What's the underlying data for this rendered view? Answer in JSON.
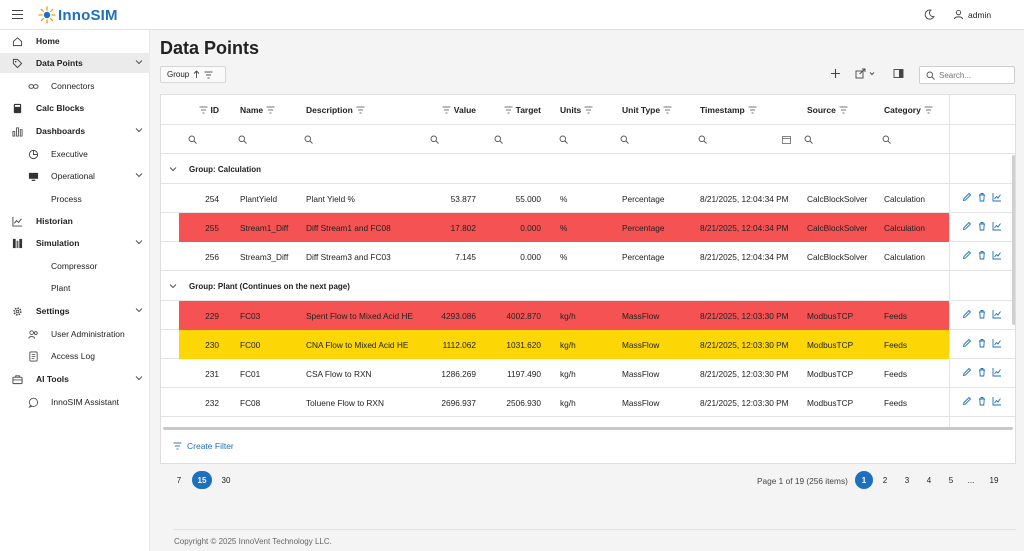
{
  "app": {
    "brand": "InnoSIM",
    "user": "admin"
  },
  "nav": {
    "home": "Home",
    "data_points": "Data Points",
    "connectors": "Connectors",
    "calc_blocks": "Calc Blocks",
    "dashboards": "Dashboards",
    "executive": "Executive",
    "operational": "Operational",
    "process": "Process",
    "historian": "Historian",
    "simulation": "Simulation",
    "compressor": "Compressor",
    "plant": "Plant",
    "settings": "Settings",
    "user_admin": "User Administration",
    "access_log": "Access Log",
    "ai_tools": "AI Tools",
    "assistant": "InnoSIM Assistant"
  },
  "page": {
    "title": "Data Points",
    "group_chip": "Group",
    "search_placeholder": "Search..."
  },
  "columns": [
    "ID",
    "Name",
    "Description",
    "Value",
    "Target",
    "Units",
    "Unit Type",
    "Timestamp",
    "Source",
    "Category"
  ],
  "groups": [
    {
      "label": "Group: Calculation"
    },
    {
      "label": "Group: Plant (Continues on the next page)"
    }
  ],
  "rows": [
    {
      "id": "254",
      "name": "PlantYield",
      "desc": "Plant Yield %",
      "value": "53.877",
      "target": "55.000",
      "units": "%",
      "unit_type": "Percentage",
      "ts": "8/21/2025, 12:04:34 PM",
      "source": "CalcBlockSolver",
      "category": "Calculation",
      "highlight": "none"
    },
    {
      "id": "255",
      "name": "Stream1_Diff",
      "desc": "Diff Stream1 and FC08",
      "value": "17.802",
      "target": "0.000",
      "units": "%",
      "unit_type": "Percentage",
      "ts": "8/21/2025, 12:04:34 PM",
      "source": "CalcBlockSolver",
      "category": "Calculation",
      "highlight": "red"
    },
    {
      "id": "256",
      "name": "Stream3_Diff",
      "desc": "Diff Stream3 and FC03",
      "value": "7.145",
      "target": "0.000",
      "units": "%",
      "unit_type": "Percentage",
      "ts": "8/21/2025, 12:04:34 PM",
      "source": "CalcBlockSolver",
      "category": "Calculation",
      "highlight": "none"
    },
    {
      "id": "229",
      "name": "FC03",
      "desc": "Spent Flow to Mixed Acid HE",
      "value": "4293.086",
      "target": "4002.870",
      "units": "kg/h",
      "unit_type": "MassFlow",
      "ts": "8/21/2025, 12:03:30 PM",
      "source": "ModbusTCP",
      "category": "Feeds",
      "highlight": "red"
    },
    {
      "id": "230",
      "name": "FC00",
      "desc": "CNA Flow to Mixed Acid HE",
      "value": "1112.062",
      "target": "1031.620",
      "units": "kg/h",
      "unit_type": "MassFlow",
      "ts": "8/21/2025, 12:03:30 PM",
      "source": "ModbusTCP",
      "category": "Feeds",
      "highlight": "yellow"
    },
    {
      "id": "231",
      "name": "FC01",
      "desc": "CSA Flow to RXN",
      "value": "1286.269",
      "target": "1197.490",
      "units": "kg/h",
      "unit_type": "MassFlow",
      "ts": "8/21/2025, 12:03:30 PM",
      "source": "ModbusTCP",
      "category": "Feeds",
      "highlight": "none"
    },
    {
      "id": "232",
      "name": "FC08",
      "desc": "Toluene Flow to RXN",
      "value": "2696.937",
      "target": "2506.930",
      "units": "kg/h",
      "unit_type": "MassFlow",
      "ts": "8/21/2025, 12:03:30 PM",
      "source": "ModbusTCP",
      "category": "Feeds",
      "highlight": "none"
    }
  ],
  "create_filter": "Create Filter",
  "pager": {
    "sizes": [
      "7",
      "15",
      "30"
    ],
    "selected_size": "15",
    "info": "Page 1 of 19 (256 items)",
    "pages": [
      "1",
      "2",
      "3",
      "4",
      "5",
      "...",
      "19"
    ],
    "current_page": "1"
  },
  "footer": "Copyright © 2025 InnoVent Technology LLC.",
  "colors": {
    "accent": "#1d6fbf",
    "red": "#f55353",
    "yellow": "#fcd705"
  }
}
